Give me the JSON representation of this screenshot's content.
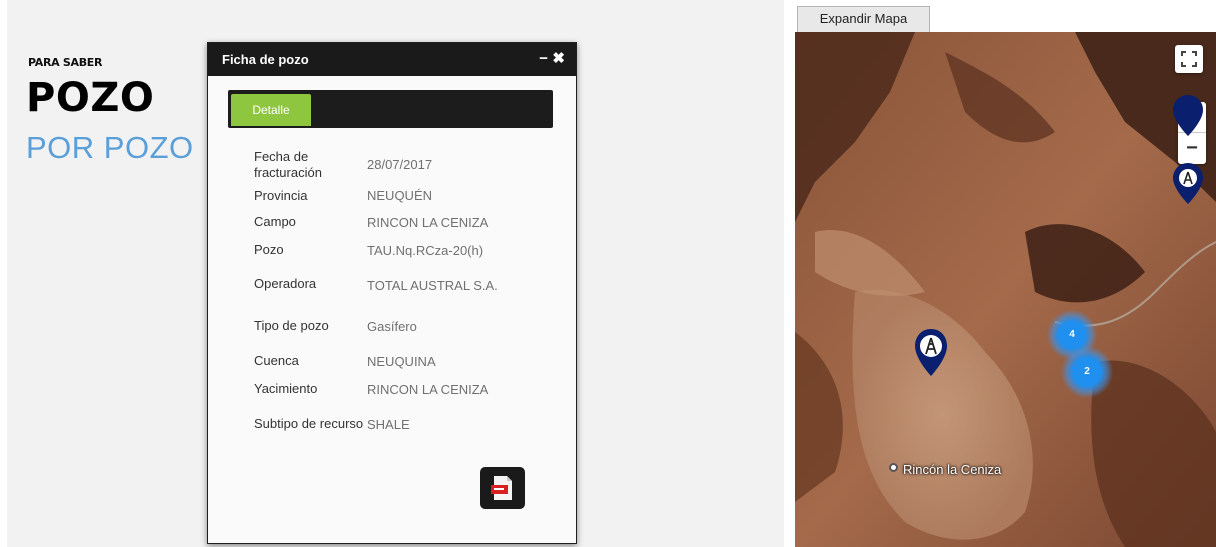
{
  "brand": {
    "line1": "PARA SABER",
    "line2": "POZO",
    "line3": "POR POZO"
  },
  "dialog": {
    "title": "Ficha de pozo",
    "minimize_glyph": "−",
    "close_glyph": "✖",
    "tab_label": "Detalle",
    "rows": [
      {
        "key": "Fecha de fracturación",
        "value": "28/07/2017"
      },
      {
        "key": "Provincia",
        "value": "NEUQUÉN"
      },
      {
        "key": "Campo",
        "value": "RINCON LA CENIZA"
      },
      {
        "key": "Pozo",
        "value": "TAU.Nq.RCza-20(h)"
      },
      {
        "key": "Operadora",
        "value": "TOTAL AUSTRAL S.A."
      },
      {
        "key": "Tipo de pozo",
        "value": "Gasífero"
      },
      {
        "key": "Cuenca",
        "value": "NEUQUINA"
      },
      {
        "key": "Yacimiento",
        "value": "RINCON LA CENIZA"
      },
      {
        "key": "Subtipo de recurso",
        "value": "SHALE"
      }
    ],
    "pdf_icon": "pdf-document-icon"
  },
  "map": {
    "expand_label": "Expandir Mapa",
    "place_label": "Rincón la Ceniza",
    "cluster_a": "4",
    "cluster_b": "2",
    "zoom_in": "+",
    "zoom_out": "−",
    "icons": [
      "fullscreen-icon",
      "well-marker-icon",
      "cluster-icon"
    ]
  },
  "colors": {
    "tab_active": "#8ec63f",
    "brand_sub": "#5a9fd8",
    "cluster": "#1f8ff0",
    "marker": "#0a1f6e"
  }
}
